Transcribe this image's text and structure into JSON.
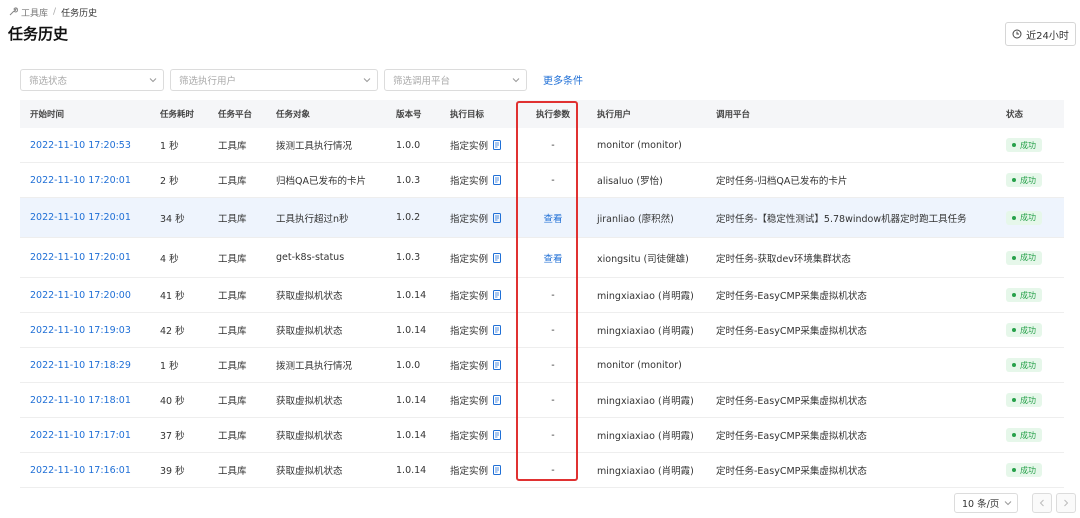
{
  "breadcrumb": {
    "parent": "工具库",
    "separator": "/",
    "current": "任务历史"
  },
  "page_title": "任务历史",
  "time_range_button": {
    "label": "近24小时",
    "icon": "clock-icon"
  },
  "filters": {
    "status_placeholder": "筛选状态",
    "user_placeholder": "筛选执行用户",
    "platform_placeholder": "筛选调用平台",
    "more_label": "更多条件"
  },
  "table": {
    "headers": {
      "start_time": "开始时间",
      "duration": "任务耗时",
      "platform": "任务平台",
      "object": "任务对象",
      "version": "版本号",
      "target": "执行目标",
      "params": "执行参数",
      "user": "执行用户",
      "caller": "调用平台",
      "status": "状态"
    },
    "rows": [
      {
        "start_time": "2022-11-10 17:20:53",
        "duration": "1 秒",
        "platform": "工具库",
        "object": "拨测工具执行情况",
        "version": "1.0.0",
        "target": "指定实例",
        "params": "-",
        "user": "monitor (monitor)",
        "caller": "",
        "status": "成功"
      },
      {
        "start_time": "2022-11-10 17:20:01",
        "duration": "2 秒",
        "platform": "工具库",
        "object": "归档QA已发布的卡片",
        "version": "1.0.3",
        "target": "指定实例",
        "params": "-",
        "user": "alisaluo (罗怡)",
        "caller": "定时任务-归档QA已发布的卡片",
        "status": "成功"
      },
      {
        "start_time": "2022-11-10 17:20:01",
        "duration": "34 秒",
        "platform": "工具库",
        "object": "工具执行超过n秒",
        "version": "1.0.2",
        "target": "指定实例",
        "params": "查看",
        "user": "jiranliao (廖积然)",
        "caller": "定时任务-【稳定性测试】5.78window机器定时跑工具任务",
        "status": "成功"
      },
      {
        "start_time": "2022-11-10 17:20:01",
        "duration": "4 秒",
        "platform": "工具库",
        "object": "get-k8s-status",
        "version": "1.0.3",
        "target": "指定实例",
        "params": "查看",
        "user": "xiongsitu (司徒健雄)",
        "caller": "定时任务-获取dev环境集群状态",
        "status": "成功"
      },
      {
        "start_time": "2022-11-10 17:20:00",
        "duration": "41 秒",
        "platform": "工具库",
        "object": "获取虚拟机状态",
        "version": "1.0.14",
        "target": "指定实例",
        "params": "-",
        "user": "mingxiaxiao (肖明霞)",
        "caller": "定时任务-EasyCMP采集虚拟机状态",
        "status": "成功"
      },
      {
        "start_time": "2022-11-10 17:19:03",
        "duration": "42 秒",
        "platform": "工具库",
        "object": "获取虚拟机状态",
        "version": "1.0.14",
        "target": "指定实例",
        "params": "-",
        "user": "mingxiaxiao (肖明霞)",
        "caller": "定时任务-EasyCMP采集虚拟机状态",
        "status": "成功"
      },
      {
        "start_time": "2022-11-10 17:18:29",
        "duration": "1 秒",
        "platform": "工具库",
        "object": "拨测工具执行情况",
        "version": "1.0.0",
        "target": "指定实例",
        "params": "-",
        "user": "monitor (monitor)",
        "caller": "",
        "status": "成功"
      },
      {
        "start_time": "2022-11-10 17:18:01",
        "duration": "40 秒",
        "platform": "工具库",
        "object": "获取虚拟机状态",
        "version": "1.0.14",
        "target": "指定实例",
        "params": "-",
        "user": "mingxiaxiao (肖明霞)",
        "caller": "定时任务-EasyCMP采集虚拟机状态",
        "status": "成功"
      },
      {
        "start_time": "2022-11-10 17:17:01",
        "duration": "37 秒",
        "platform": "工具库",
        "object": "获取虚拟机状态",
        "version": "1.0.14",
        "target": "指定实例",
        "params": "-",
        "user": "mingxiaxiao (肖明霞)",
        "caller": "定时任务-EasyCMP采集虚拟机状态",
        "status": "成功"
      },
      {
        "start_time": "2022-11-10 17:16:01",
        "duration": "39 秒",
        "platform": "工具库",
        "object": "获取虚拟机状态",
        "version": "1.0.14",
        "target": "指定实例",
        "params": "-",
        "user": "mingxiaxiao (肖明霞)",
        "caller": "定时任务-EasyCMP采集虚拟机状态",
        "status": "成功"
      }
    ]
  },
  "pagination": {
    "page_size": "10 条/页"
  },
  "colors": {
    "link": "#1f6fd6",
    "success": "#27a14a",
    "success_bg": "#e6f7ea",
    "highlight_border": "#e03131",
    "selected_row_bg": "#eef4fd"
  }
}
